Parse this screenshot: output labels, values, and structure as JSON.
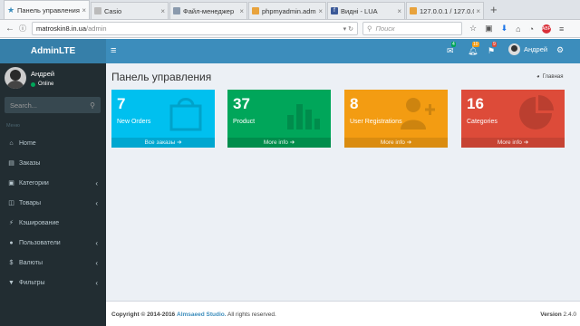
{
  "browser": {
    "tabs": [
      {
        "title": "Панель управления",
        "active": true
      },
      {
        "title": "Casio"
      },
      {
        "title": "Файл-менеджер"
      },
      {
        "title": "phpmyadmin.adm.to"
      },
      {
        "title": "Видні - LUA"
      },
      {
        "title": "127.0.0.1 / 127.0.0.1 /"
      }
    ],
    "new_tab": "+",
    "url_host": "matroskin8.in.ua",
    "url_path": "/admin",
    "search_placeholder": "Поиск"
  },
  "app": {
    "logo": "AdminLTE",
    "navbar": {
      "mail_badge": "4",
      "bell_badge": "10",
      "flag_badge": "9",
      "user_name": "Андрей"
    },
    "sidebar": {
      "user_name": "Андрей",
      "user_status": "Online",
      "search_placeholder": "Search...",
      "menu_header": "Меню",
      "items": [
        {
          "label": "Home",
          "icon": "home-icon",
          "chevron": false
        },
        {
          "label": "Заказы",
          "icon": "orders-icon",
          "chevron": false
        },
        {
          "label": "Категории",
          "icon": "categories-icon",
          "chevron": true
        },
        {
          "label": "Товары",
          "icon": "products-icon",
          "chevron": true
        },
        {
          "label": "Кэширование",
          "icon": "cache-icon",
          "chevron": false
        },
        {
          "label": "Пользователи",
          "icon": "users-icon",
          "chevron": true
        },
        {
          "label": "Валюты",
          "icon": "currency-icon",
          "chevron": true
        },
        {
          "label": "Фильтры",
          "icon": "filters-icon",
          "chevron": true
        }
      ]
    },
    "content": {
      "title": "Панель управления",
      "breadcrumb": "Главная",
      "boxes": [
        {
          "value": "7",
          "label": "New Orders",
          "footer": "Все заказы",
          "color": "#00c0ef",
          "footer_color": "#00a7d0",
          "icon": "shopping-bag-icon"
        },
        {
          "value": "37",
          "label": "Product",
          "footer": "More info",
          "color": "#00a65a",
          "footer_color": "#008d4c",
          "icon": "bar-chart-icon"
        },
        {
          "value": "8",
          "label": "User Registrations",
          "footer": "More info",
          "color": "#f39c12",
          "footer_color": "#da8c10",
          "icon": "user-add-icon"
        },
        {
          "value": "16",
          "label": "Categories",
          "footer": "More info",
          "color": "#dd4b39",
          "footer_color": "#c64333",
          "icon": "pie-chart-icon"
        }
      ]
    },
    "footer": {
      "copyright_prefix": "Copyright © 2014-2016",
      "studio": "Almsaeed Studio.",
      "rights": "All rights reserved.",
      "version_label": "Version",
      "version_value": "2.4.0"
    }
  }
}
